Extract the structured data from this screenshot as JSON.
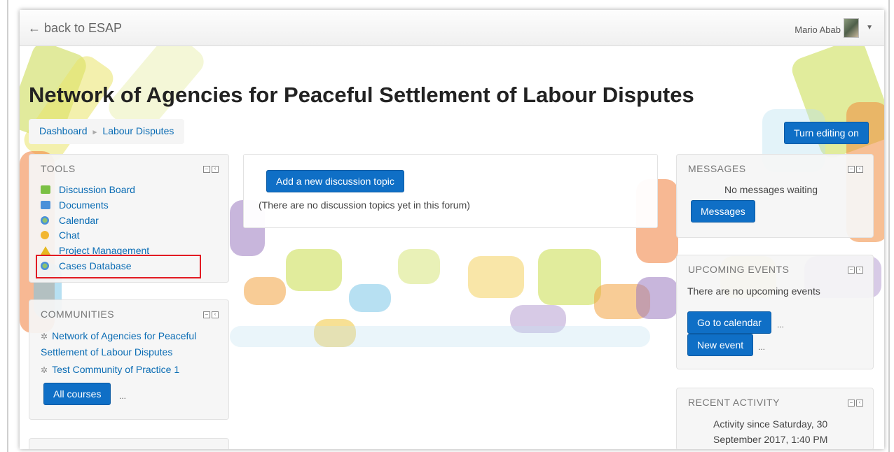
{
  "navbar": {
    "back_label": "← back to ESAP",
    "user_name": "Mario Abab",
    "caret": "▼"
  },
  "page": {
    "title": "Network of Agencies for Peaceful Settlement of Labour Disputes",
    "edit_button": "Turn editing on"
  },
  "breadcrumb": {
    "items": [
      "Dashboard",
      "Labour Disputes"
    ],
    "separator": "►"
  },
  "tools": {
    "title": "TOOLS",
    "items": [
      {
        "label": "Discussion Board",
        "icon": "discussion-icon"
      },
      {
        "label": "Documents",
        "icon": "folder-icon"
      },
      {
        "label": "Calendar",
        "icon": "calendar-icon"
      },
      {
        "label": "Chat",
        "icon": "chat-icon"
      },
      {
        "label": "Project Management",
        "icon": "project-icon"
      },
      {
        "label": "Cases Database",
        "icon": "database-icon"
      }
    ]
  },
  "communities": {
    "title": "COMMUNITIES",
    "items": [
      "Network of Agencies for Peaceful Settlement of Labour Disputes",
      "Test Community of Practice 1"
    ],
    "all_courses": "All courses",
    "ellipsis": "..."
  },
  "forum": {
    "add_button": "Add a new discussion topic",
    "empty_text": "(There are no discussion topics yet in this forum)"
  },
  "messages": {
    "title": "MESSAGES",
    "empty_text": "No messages waiting",
    "button": "Messages"
  },
  "events": {
    "title": "UPCOMING EVENTS",
    "empty_text": "There are no upcoming events",
    "calendar_button": "Go to calendar",
    "new_event_button": "New event",
    "ellipsis": "..."
  },
  "recent": {
    "title": "RECENT ACTIVITY",
    "line1": "Activity since Saturday, 30",
    "line2": "September 2017, 1:40 PM"
  },
  "colors": {
    "link": "#0a6cb4",
    "button": "#0f6fc6",
    "highlight": "#e21b23"
  }
}
